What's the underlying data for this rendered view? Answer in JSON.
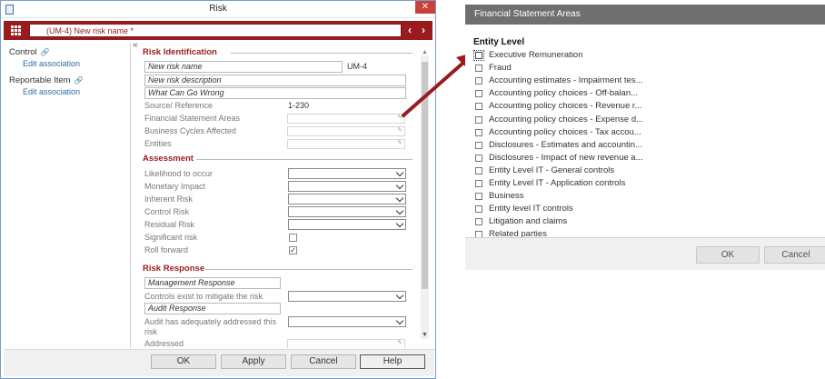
{
  "risk_window": {
    "title": "Risk",
    "close_glyph": "✕",
    "header": {
      "name_value": "(UM-4)  New risk name *",
      "prev_glyph": "‹",
      "next_glyph": "›"
    },
    "left_panel": {
      "collapse_glyph": "«",
      "categories": [
        {
          "label": "Control",
          "assoc": "Edit association"
        },
        {
          "label": "Reportable Item",
          "assoc": "Edit association"
        }
      ]
    },
    "identification": {
      "title": "Risk Identification",
      "name_value": "New risk name",
      "id_value": "UM-4",
      "description_value": "New risk description",
      "what_can_go_wrong_value": "What Can Go Wrong",
      "source_label": "Source/ Reference",
      "source_value": "1-230",
      "fsa_label": "Financial Statement Areas",
      "cycles_label": "Business Cycles Affected",
      "entities_label": "Entities"
    },
    "assessment": {
      "title": "Assessment",
      "likelihood_label": "Likelihood to occur",
      "monetary_label": "Monetary Impact",
      "inherent_label": "Inherent Risk",
      "control_label": "Control Risk",
      "residual_label": "Residual Risk",
      "significant_label": "Significant risk",
      "rollforward_label": "Roll forward"
    },
    "response": {
      "title": "Risk Response",
      "management_value": "Management Response",
      "controls_exist_label": "Controls exist to mitigate the risk",
      "audit_value": "Audit Response",
      "audit_addressed_label_1": "Audit has adequately addressed this",
      "audit_addressed_label_2": "risk",
      "addressed_label": "Addressed"
    },
    "footer": {
      "ok": "OK",
      "apply": "Apply",
      "cancel": "Cancel",
      "help": "Help"
    }
  },
  "fsa_dialog": {
    "title": "Financial Statement Areas",
    "group_title": "Entity Level",
    "items": [
      "Executive Remuneration",
      "Fraud",
      "Accounting estimates - Impairment tes...",
      "Accounting policy choices - Off-balan...",
      "Accounting policy choices - Revenue r...",
      "Accounting policy choices - Expense d...",
      "Accounting policy choices - Tax accou...",
      "Disclosures - Estimates and accountin...",
      "Disclosures - Impact of new revenue a...",
      "Entity Level IT - General controls",
      "Entity Level IT - Application controls",
      "Business",
      "Entity level IT controls",
      "Litigation and claims",
      "Related parties"
    ],
    "ok": "OK",
    "cancel": "Cancel"
  },
  "colors": {
    "brand_red": "#9a1b1e",
    "link_blue": "#2e6da4",
    "dialog_title_gray": "#6f6f6f"
  }
}
